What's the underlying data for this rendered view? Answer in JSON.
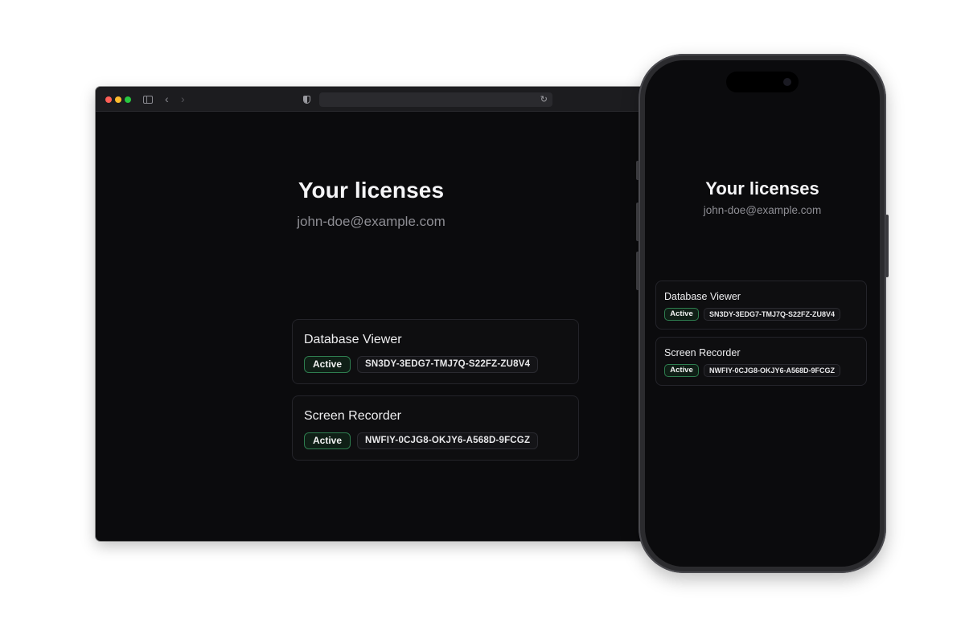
{
  "page": {
    "title": "Your licenses",
    "email": "john-doe@example.com"
  },
  "licenses": [
    {
      "product": "Database Viewer",
      "status": "Active",
      "key": "SN3DY-3EDG7-TMJ7Q-S22FZ-ZU8V4"
    },
    {
      "product": "Screen Recorder",
      "status": "Active",
      "key": "NWFIY-0CJG8-OKJY6-A568D-9FCGZ"
    }
  ],
  "browser": {
    "icons": {
      "close": "red-dot",
      "minimize": "yellow-dot",
      "zoom": "green-dot",
      "sidebar": "sidebar-icon",
      "back": "chevron-left-icon",
      "forward": "chevron-right-icon",
      "privacy": "shield-icon",
      "reload": "reload-icon"
    }
  },
  "colors": {
    "background": "#0b0b0d",
    "card_border": "#24242a",
    "badge_border": "#2e7d4f",
    "text_primary": "#f5f5f7",
    "text_secondary": "#8e8e94"
  }
}
